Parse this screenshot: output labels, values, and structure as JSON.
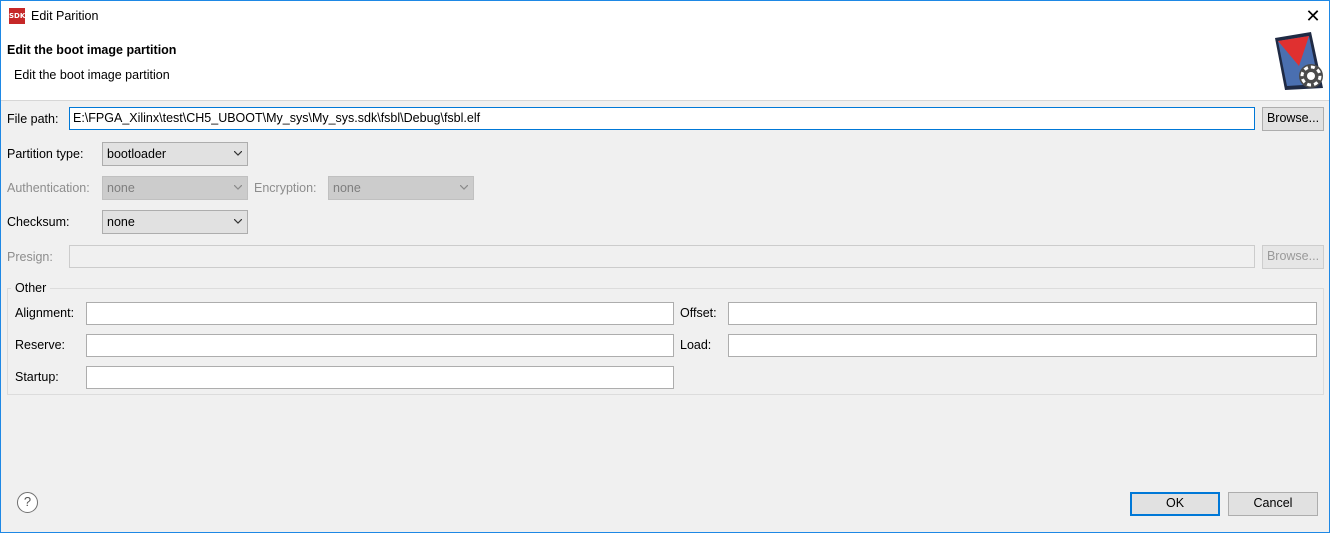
{
  "window": {
    "title": "Edit Parition",
    "app_icon_text": "SDK",
    "close_label": "✕"
  },
  "header": {
    "title": "Edit the boot image partition",
    "description": "Edit the boot image partition"
  },
  "form": {
    "file_path": {
      "label": "File path:",
      "value": "E:\\FPGA_Xilinx\\test\\CH5_UBOOT\\My_sys\\My_sys.sdk\\fsbl\\Debug\\fsbl.elf",
      "browse": "Browse..."
    },
    "partition_type": {
      "label": "Partition type:",
      "value": "bootloader"
    },
    "authentication": {
      "label": "Authentication:",
      "value": "none"
    },
    "encryption": {
      "label": "Encryption:",
      "value": "none"
    },
    "checksum": {
      "label": "Checksum:",
      "value": "none"
    },
    "presign": {
      "label": "Presign:",
      "value": "",
      "browse": "Browse..."
    }
  },
  "other": {
    "label": "Other",
    "alignment": {
      "label": "Alignment:",
      "value": ""
    },
    "offset": {
      "label": "Offset:",
      "value": ""
    },
    "reserve": {
      "label": "Reserve:",
      "value": ""
    },
    "load": {
      "label": "Load:",
      "value": ""
    },
    "startup": {
      "label": "Startup:",
      "value": ""
    }
  },
  "footer": {
    "help": "?",
    "ok": "OK",
    "cancel": "Cancel"
  },
  "colors": {
    "accent": "#0078d7",
    "icon_red": "#c62828"
  }
}
